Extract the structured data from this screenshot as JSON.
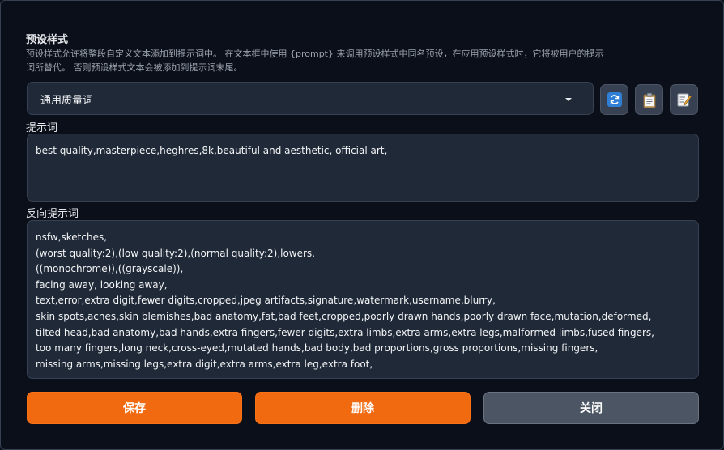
{
  "section": {
    "title": "预设样式",
    "description": "预设样式允许将整段自定义文本添加到提示词中。 在文本框中使用 {prompt} 来调用预设样式中同名预设，在应用预设样式时，它将被用户的提示词所替代。 否则预设样式文本会被添加到提示词末尾。"
  },
  "style_select": {
    "selected": "通用质量词"
  },
  "toolbar": {
    "refresh_icon": "refresh-icon",
    "copy_icon": "clipboard-icon",
    "edit_icon": "edit-icon"
  },
  "prompt": {
    "label": "提示词",
    "value": "best quality,masterpiece,heghres,8k,beautiful and aesthetic, official art,"
  },
  "negative_prompt": {
    "label": "反向提示词",
    "value": "nsfw,sketches,\n(worst quality:2),(low quality:2),(normal quality:2),lowers,\n((monochrome)),((grayscale)),\nfacing away, looking away,\ntext,error,extra digit,fewer digits,cropped,jpeg artifacts,signature,watermark,username,blurry,\nskin spots,acnes,skin blemishes,bad anatomy,fat,bad feet,cropped,poorly drawn hands,poorly drawn face,mutation,deformed,\ntilted head,bad anatomy,bad hands,extra fingers,fewer digits,extra limbs,extra arms,extra legs,malformed limbs,fused fingers,\ntoo many fingers,long neck,cross-eyed,mutated hands,bad body,bad proportions,gross proportions,missing fingers,\nmissing arms,missing legs,extra digit,extra arms,extra leg,extra foot,"
  },
  "buttons": {
    "save": "保存",
    "delete": "删除",
    "close": "关闭"
  },
  "colors": {
    "primary": "#f26a10",
    "secondary": "#4b5563",
    "background": "#0b0f19",
    "field": "#1f2937"
  }
}
